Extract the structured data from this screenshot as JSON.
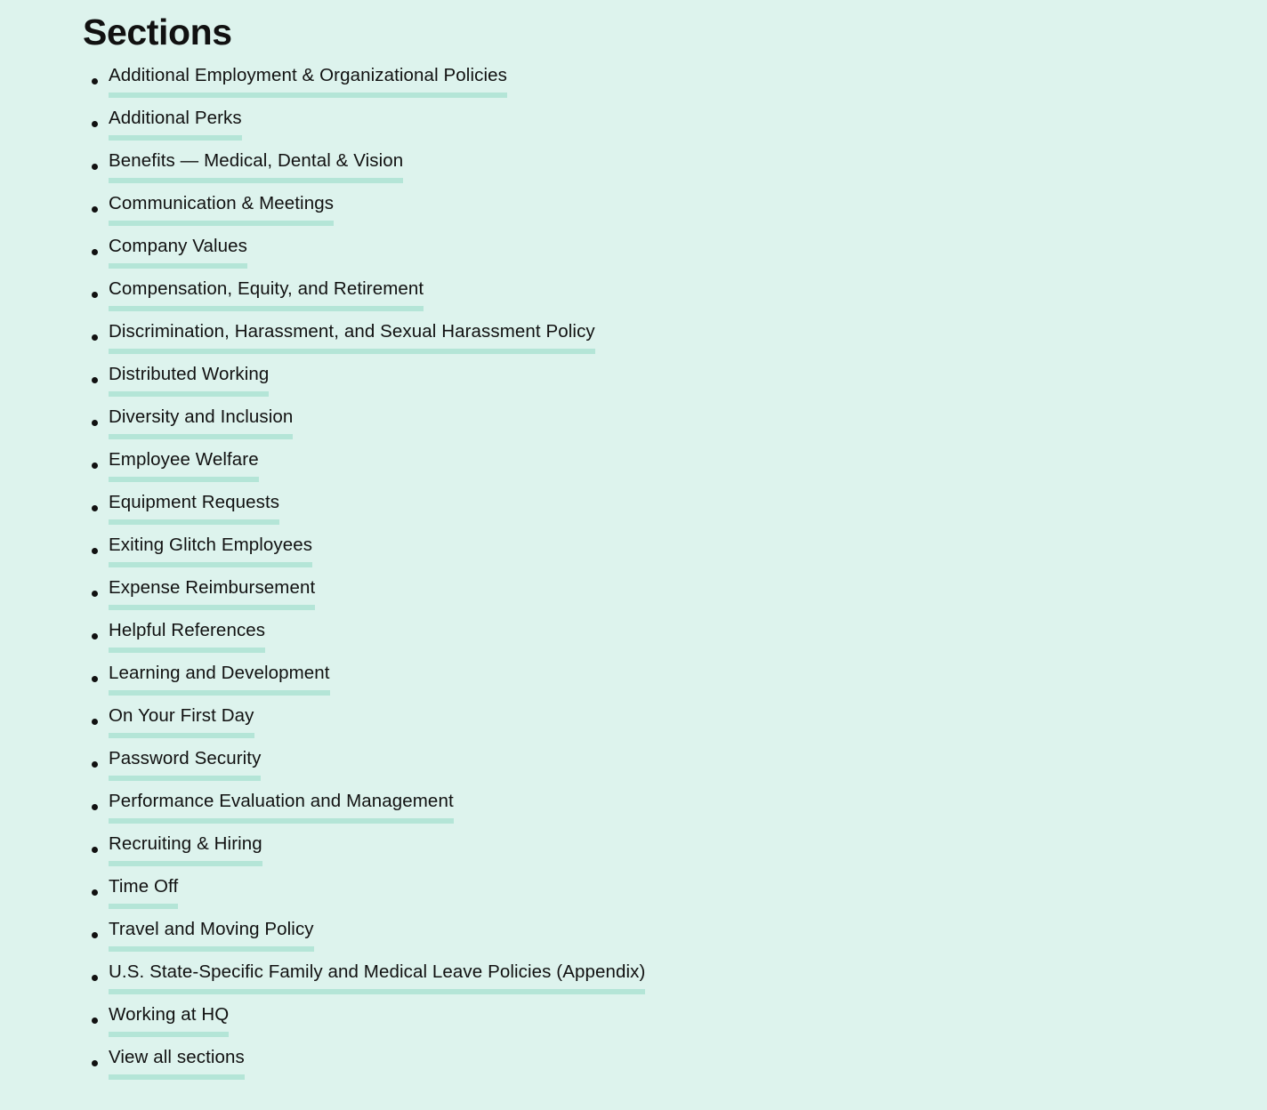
{
  "page": {
    "background_color": "#ddf3ed",
    "text_color": "#111111",
    "highlight_color": "#b4e5d7",
    "title": "Sections"
  },
  "sections": {
    "heading": "Sections",
    "items": [
      {
        "label": "Additional Employment & Organizational Policies"
      },
      {
        "label": "Additional Perks"
      },
      {
        "label": "Benefits — Medical, Dental & Vision"
      },
      {
        "label": "Communication & Meetings"
      },
      {
        "label": "Company Values"
      },
      {
        "label": "Compensation, Equity, and Retirement"
      },
      {
        "label": "Discrimination, Harassment, and Sexual Harassment Policy"
      },
      {
        "label": "Distributed Working"
      },
      {
        "label": "Diversity and Inclusion"
      },
      {
        "label": "Employee Welfare"
      },
      {
        "label": "Equipment Requests"
      },
      {
        "label": "Exiting Glitch Employees"
      },
      {
        "label": "Expense Reimbursement"
      },
      {
        "label": "Helpful References"
      },
      {
        "label": "Learning and Development"
      },
      {
        "label": "On Your First Day"
      },
      {
        "label": "Password Security"
      },
      {
        "label": "Performance Evaluation and Management"
      },
      {
        "label": "Recruiting & Hiring"
      },
      {
        "label": "Time Off"
      },
      {
        "label": "Travel and Moving Policy"
      },
      {
        "label": "U.S. State-Specific Family and Medical Leave Policies (Appendix)"
      },
      {
        "label": "Working at HQ"
      },
      {
        "label": "View all sections"
      }
    ]
  }
}
